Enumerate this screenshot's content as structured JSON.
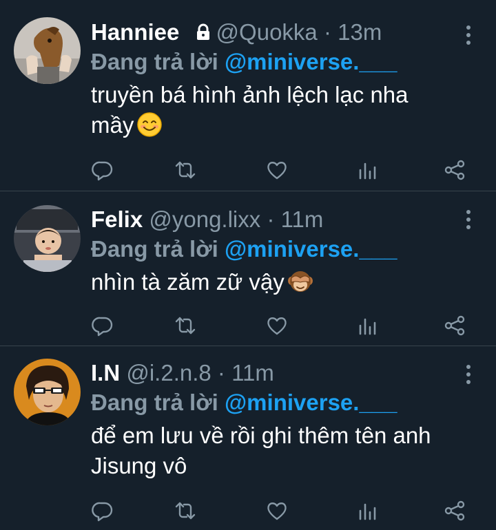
{
  "tweets": [
    {
      "name": "Hanniee",
      "handle": "@Quokka",
      "time": "13m",
      "reply_prefix": "Đang trả lời",
      "reply_to": "@miniverse.___",
      "text": "truyền bá hình ảnh lệch lạc nha mầy",
      "emoji": "smiling-face-emoji",
      "protected": true
    },
    {
      "name": "Felix",
      "handle": "@yong.lixx",
      "time": "11m",
      "reply_prefix": "Đang trả lời",
      "reply_to": "@miniverse.___",
      "text": "nhìn tà zăm zữ vậy",
      "emoji": "see-no-evil-monkey-emoji",
      "protected": false
    },
    {
      "name": "I.N",
      "handle": "@i.2.n.8",
      "time": "11m",
      "reply_prefix": "Đang trả lời",
      "reply_to": "@miniverse.___",
      "text": "để em lưu về rồi ghi thêm tên anh Jisung vô",
      "emoji": "",
      "protected": false
    }
  ],
  "separator": "·",
  "colors": {
    "background": "#15202b",
    "divider": "#38444d",
    "secondary_text": "#8899a6",
    "mention": "#1da1f2",
    "icon": "#8899a6"
  },
  "icons": {
    "reply": "reply-icon",
    "retweet": "retweet-icon",
    "like": "like-icon",
    "stats": "analytics-icon",
    "share": "share-icon",
    "more": "more-options-icon",
    "lock": "lock-icon"
  }
}
